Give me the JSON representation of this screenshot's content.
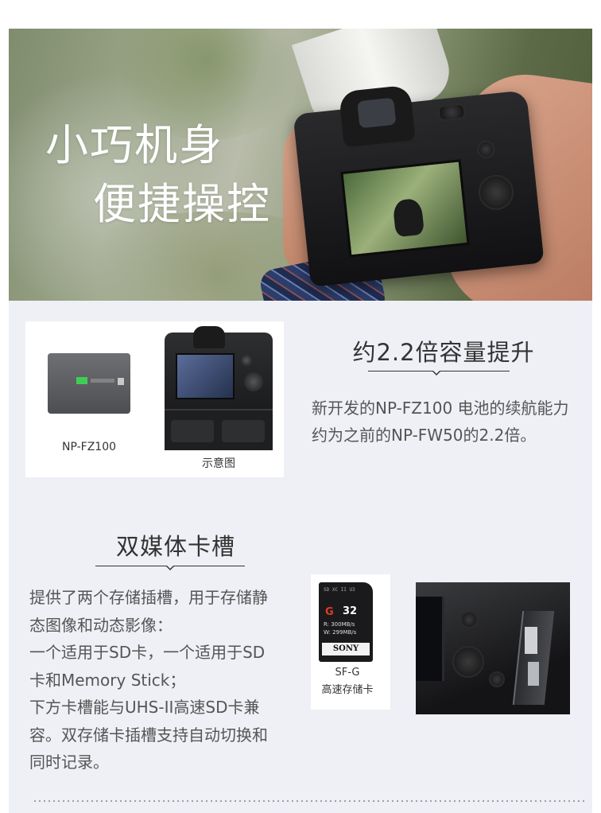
{
  "hero": {
    "title_line1": "小巧机身",
    "title_line2": "便捷操控"
  },
  "battery_section": {
    "heading": "约2.2倍容量提升",
    "description": "新开发的NP-FZ100 电池的续航能力约为之前的NP-FW50的2.2倍。",
    "battery_caption": "NP-FZ100",
    "grip_caption": "示意图"
  },
  "card_section": {
    "heading": "双媒体卡槽",
    "lines": [
      "提供了两个存储插槽，用于存储静",
      "态图像和动态影像：",
      "一个适用于SD卡，一个适用于SD",
      "卡和Memory Stick；",
      "下方卡槽能与UHS-II高速SD卡兼",
      "容。双存储卡插槽支持自动切换和",
      "同时记录。"
    ],
    "sd_card": {
      "capacity": "32",
      "speed_class": "G",
      "spec_r": "R: 300MB/s",
      "spec_w": "W: 299MB/s",
      "brand": "SONY"
    },
    "sd_caption_line1": "SF-G",
    "sd_caption_line2": "高速存储卡"
  },
  "colors": {
    "panel_background": "#eef0f6",
    "text": "#3a3a3a",
    "battery_indicator": "#3fce54"
  }
}
